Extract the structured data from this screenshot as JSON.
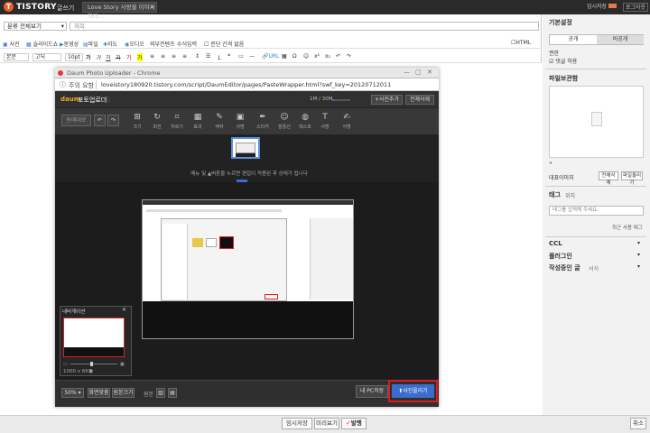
{
  "topbar": {
    "brand": "TISTORY",
    "write_label": "글쓰기",
    "post_select": "Love Story 사랑을 이야기하다...",
    "temp_saved": "임시저장",
    "logout": "로그아웃"
  },
  "editor": {
    "category": "분류 전체보기",
    "title_placeholder": "제목",
    "toolbar1": [
      "사진",
      "슬라이드쇼",
      "동영상",
      "파일",
      "지도",
      "오디오",
      "외부컨텐츠",
      "수식입력",
      "문단 간격 없음"
    ],
    "html_label": "HTML",
    "toolbar2": {
      "paragraph": "본문",
      "font": "고딕",
      "size": "10pt",
      "url_label": "URL"
    }
  },
  "sidebar": {
    "basic_settings": "기본설정",
    "public": "공개",
    "private": "비공개",
    "permission": "권한",
    "allow_comments": "댓글 허용",
    "file_storage": "파일보관함",
    "cover": "대표이미지",
    "delete_all": "전체삭제",
    "file_upload": "파일올리기",
    "tags": "태그",
    "location": "위치",
    "tag_placeholder": "태그를 입력해 주세요.",
    "recent_tags": "최근 사용 태그",
    "ccl": "CCL",
    "plugin": "플러그인",
    "related": "작성중인 글",
    "related_tab": "서식"
  },
  "popup": {
    "title": "Daum Photo Uploader - Chrome",
    "url_warning": "주의 요함",
    "url": "loveistory180920.tistory.com/script/DaumEditor/pages/PasteWrapper.html?swf_key=20120712011",
    "app_name": "포토업로더",
    "size_info": "1M / 30M",
    "add_photo": "사진추가",
    "delete_all": "전체삭제",
    "restore": "원래대로",
    "tools": [
      "크기",
      "회전",
      "자르기",
      "효과",
      "액자",
      "서명",
      "스티커",
      "말풍선",
      "텍스트",
      "서명"
    ],
    "hint": "메뉴 및 ▲버튼을 누르면 편집이 적용된 후 상태가 됩니다",
    "navigator_title": "내비게이션",
    "image_size": "1000 x 667",
    "zoom": "50%",
    "fit_screen": "화면맞춤",
    "original": "원본크기",
    "compare": "원본",
    "save_pc": "내 PC저장",
    "upload": "사진올리기"
  },
  "bottom": {
    "temp_save": "임시저장",
    "preview": "미리보기",
    "publish": "발행",
    "cancel": "취소"
  },
  "colors": {
    "accent_orange": "#ef5a24",
    "upload_blue": "#3d6dcc",
    "highlight_red": "#e01a1a"
  }
}
